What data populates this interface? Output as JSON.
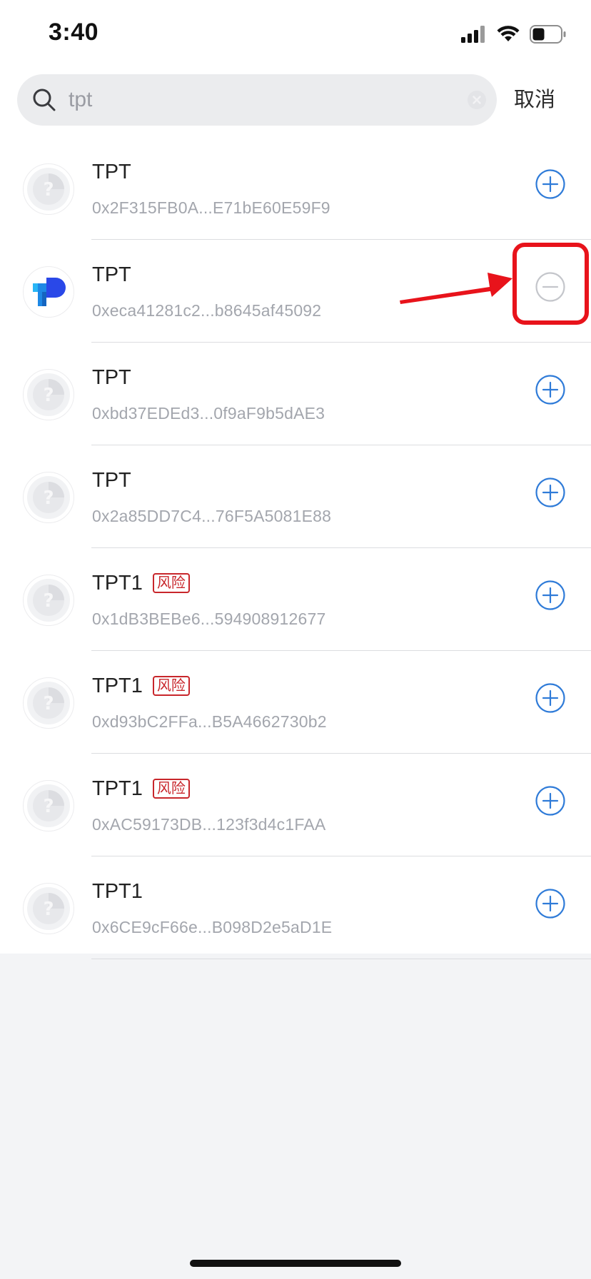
{
  "status_bar": {
    "time": "3:40"
  },
  "search": {
    "value": "tpt",
    "cancel_label": "取消"
  },
  "risk_label": "风险",
  "tokens": [
    {
      "name": "TPT",
      "address": "0x2F315FB0A...E71bE60E59F9",
      "logo": "unknown-token-icon",
      "risk": false,
      "action": "add"
    },
    {
      "name": "TPT",
      "address": "0xeca41281c2...b8645af45092",
      "logo": "tokenpocket-logo",
      "risk": false,
      "action": "remove"
    },
    {
      "name": "TPT",
      "address": "0xbd37EDEd3...0f9aF9b5dAE3",
      "logo": "unknown-token-icon",
      "risk": false,
      "action": "add"
    },
    {
      "name": "TPT",
      "address": "0x2a85DD7C4...76F5A5081E88",
      "logo": "unknown-token-icon",
      "risk": false,
      "action": "add"
    },
    {
      "name": "TPT1",
      "address": "0x1dB3BEBe6...594908912677",
      "logo": "unknown-token-icon",
      "risk": true,
      "action": "add"
    },
    {
      "name": "TPT1",
      "address": "0xd93bC2FFa...B5A4662730b2",
      "logo": "unknown-token-icon",
      "risk": true,
      "action": "add"
    },
    {
      "name": "TPT1",
      "address": "0xAC59173DB...123f3d4c1FAA",
      "logo": "unknown-token-icon",
      "risk": true,
      "action": "add"
    },
    {
      "name": "TPT1",
      "address": "0x6CE9cF66e...B098D2e5aD1E",
      "logo": "unknown-token-icon",
      "risk": false,
      "action": "add"
    }
  ],
  "colors": {
    "accent_blue": "#2f7bd8",
    "risk_red": "#c8262b",
    "annotation_red": "#e8131b",
    "remove_gray": "#c4c6cb"
  }
}
